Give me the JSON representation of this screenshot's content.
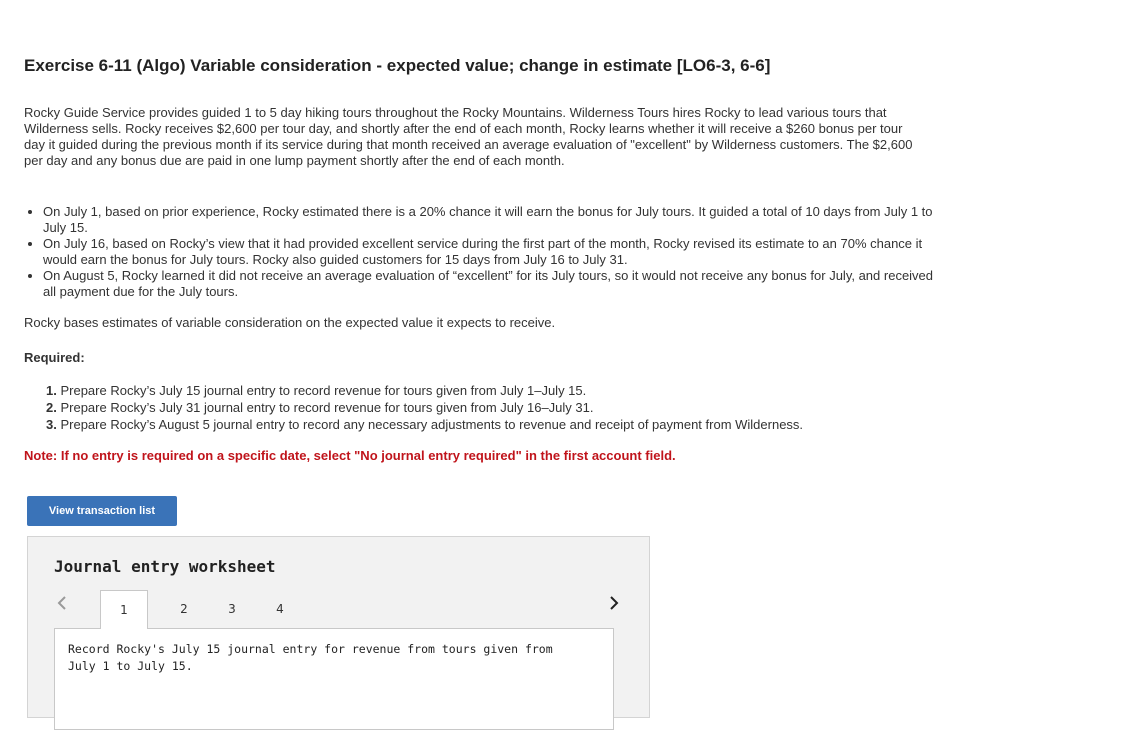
{
  "exercise": {
    "title": "Exercise 6-11 (Algo) Variable consideration - expected value; change in estimate [LO6-3, 6-6]",
    "intro": "Rocky Guide Service provides guided 1 to 5 day hiking tours throughout the Rocky Mountains. Wilderness Tours hires Rocky to lead various tours that Wilderness sells. Rocky receives $2,600 per tour day, and shortly after the end of each month, Rocky learns whether it will receive a $260 bonus per tour day it guided during the previous month if its service during that month received an average evaluation of \"excellent\" by Wilderness customers. The $2,600 per day and any bonus due are paid in one lump payment shortly after the end of each month.",
    "bullets": [
      "On July 1, based on prior experience, Rocky estimated there is a 20% chance it will earn the bonus for July tours. It guided a total of 10 days from July 1 to July 15.",
      "On July 16, based on Rocky’s view that it had provided excellent service during the first part of the month, Rocky revised its estimate to an 70% chance it would earn the bonus for July tours. Rocky also guided customers for 15 days from July 16 to July 31.",
      "On August 5, Rocky learned it did not receive an average evaluation of “excellent” for its July tours, so it would not receive any bonus for July, and received all payment due for the July tours."
    ],
    "basis": "Rocky bases estimates of variable consideration on the expected value it expects to receive.",
    "required_label": "Required:",
    "requirements": [
      {
        "num": "1.",
        "text": "Prepare Rocky’s July 15 journal entry to record revenue for tours given from July 1–July 15."
      },
      {
        "num": "2.",
        "text": "Prepare Rocky’s July 31 journal entry to record revenue for tours given from July 16–July 31."
      },
      {
        "num": "3.",
        "text": "Prepare Rocky’s August 5 journal entry to record any necessary adjustments to revenue and receipt of payment from Wilderness."
      }
    ],
    "note": "Note: If no entry is required on a specific date, select \"No journal entry required\" in the first account field."
  },
  "view_button": {
    "label": "View transaction list"
  },
  "worksheet": {
    "title": "Journal entry worksheet",
    "tabs": [
      "1",
      "2",
      "3",
      "4"
    ],
    "active_tab": 0,
    "instruction": "Record Rocky's July 15 journal entry for revenue from tours given from July 1 to July 15.",
    "prev_icon": "chevron-left-icon",
    "next_icon": "chevron-right-icon"
  },
  "colors": {
    "button_bg": "#3a73b8",
    "note_red": "#c0141b",
    "worksheet_bg": "#f2f2f2"
  }
}
